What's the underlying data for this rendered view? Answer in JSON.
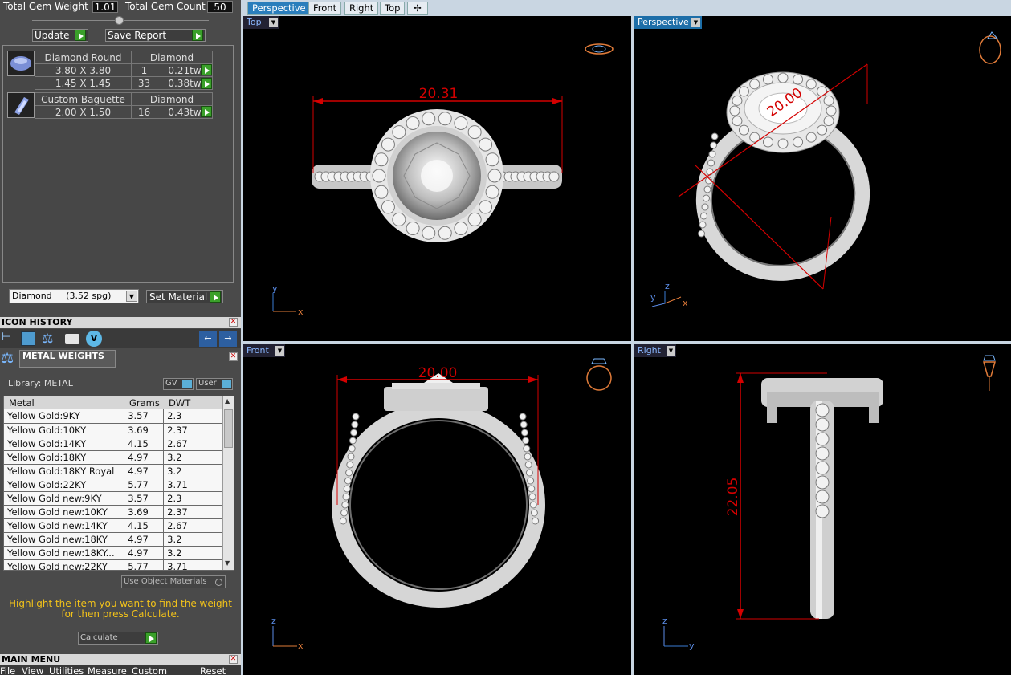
{
  "gem_summary": {
    "weight_label": "Total Gem Weight",
    "weight_value": "1.01",
    "count_label": "Total Gem Count",
    "count_value": "50",
    "update_label": "Update",
    "save_report_label": "Save Report"
  },
  "gems": {
    "round": {
      "name": "Diamond Round",
      "material": "Diamond",
      "rows": [
        {
          "size": "3.80 X 3.80",
          "qty": "1",
          "weight": "0.21tw"
        },
        {
          "size": "1.45 X 1.45",
          "qty": "33",
          "weight": "0.38tw"
        }
      ]
    },
    "baguette": {
      "name": "Custom Baguette",
      "material": "Diamond",
      "rows": [
        {
          "size": "2.00 X 1.50",
          "qty": "16",
          "weight": "0.43tw"
        }
      ]
    }
  },
  "material": {
    "select_value": "Diamond     (3.52 spg)",
    "set_label": "Set Material"
  },
  "icon_history": {
    "title": "ICON HISTORY"
  },
  "metal_weights": {
    "title": "METAL WEIGHTS",
    "library_label": "Library: METAL",
    "gv_label": "GV",
    "user_label": "User",
    "columns": [
      "Metal",
      "Grams",
      "DWT"
    ],
    "rows": [
      {
        "metal": "Yellow Gold:9KY",
        "grams": "3.57",
        "dwt": "2.3"
      },
      {
        "metal": "Yellow Gold:10KY",
        "grams": "3.69",
        "dwt": "2.37"
      },
      {
        "metal": "Yellow Gold:14KY",
        "grams": "4.15",
        "dwt": "2.67"
      },
      {
        "metal": "Yellow Gold:18KY",
        "grams": "4.97",
        "dwt": "3.2"
      },
      {
        "metal": "Yellow Gold:18KY Royal",
        "grams": "4.97",
        "dwt": "3.2"
      },
      {
        "metal": "Yellow Gold:22KY",
        "grams": "5.77",
        "dwt": "3.71"
      },
      {
        "metal": "Yellow Gold new:9KY",
        "grams": "3.57",
        "dwt": "2.3"
      },
      {
        "metal": "Yellow Gold new:10KY",
        "grams": "3.69",
        "dwt": "2.37"
      },
      {
        "metal": "Yellow Gold new:14KY",
        "grams": "4.15",
        "dwt": "2.67"
      },
      {
        "metal": "Yellow Gold new:18KY",
        "grams": "4.97",
        "dwt": "3.2"
      },
      {
        "metal": "Yellow Gold new:18KY...",
        "grams": "4.97",
        "dwt": "3.2"
      },
      {
        "metal": "Yellow Gold new:22KY",
        "grams": "5.77",
        "dwt": "3.71"
      }
    ],
    "use_object_label": "Use Object Materials",
    "help_text_1": "Highlight the item you want to find the weight",
    "help_text_2": "for then press Calculate.",
    "calculate_label": "Calculate"
  },
  "main_menu": {
    "title": "MAIN MENU",
    "items": [
      "File",
      "View",
      "Utilities",
      "Measure",
      "Custom"
    ],
    "reset_label": "Reset"
  },
  "tabs": [
    "Perspective",
    "Front",
    "Right",
    "Top"
  ],
  "viewports": {
    "top": {
      "label": "Top",
      "dimension": "20.31",
      "axis_a": "y",
      "axis_b": "x"
    },
    "perspective": {
      "label": "Perspective",
      "dimension": "20.00",
      "axis_a": "z",
      "axis_b": "y",
      "axis_c": "x"
    },
    "front": {
      "label": "Front",
      "dimension": "20.00",
      "axis_a": "z",
      "axis_b": "x"
    },
    "right": {
      "label": "Right",
      "dimension": "22.05",
      "axis_a": "z",
      "axis_b": "y"
    }
  },
  "colors": {
    "accent": "#2a7ebc",
    "dimension": "#d40000",
    "help_text": "#f2c21a",
    "ok_button": "#3aa02a"
  }
}
